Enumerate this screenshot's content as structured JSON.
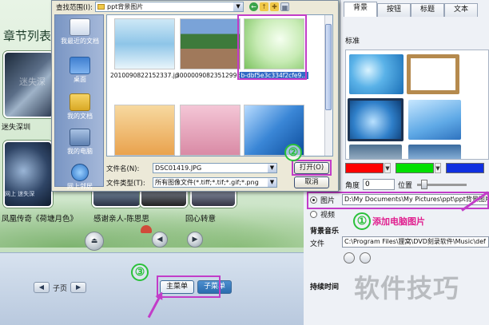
{
  "editor": {
    "chapter_title": "章节列表",
    "thumb1_watermark": "迷失深",
    "thumb1_caption": "迷失深圳",
    "thumb2_overlay": "网上 迷失深",
    "captions": [
      "凤凰传奇《荷塘月色》",
      "感谢亲人-陈思思",
      "回心转意"
    ],
    "up_button": "⏏",
    "prev_button": "◀",
    "next_button": "▶",
    "page_nav": {
      "prev": "◀",
      "label": "子页",
      "next": "▶"
    },
    "tabs": {
      "main_menu": "主菜单",
      "sub_menu": "子菜单"
    }
  },
  "panel": {
    "tabs": [
      "背景",
      "按钮",
      "标题",
      "文本"
    ],
    "active_tab": "背景",
    "standard_label": "标准",
    "colors": [
      "#ff0000",
      "#00e000",
      "#1030e0"
    ],
    "angle_label": "角度",
    "angle_value": "0",
    "position_label": "位置",
    "position_value": 0.1,
    "image_label": "图片",
    "image_path": "D:\\My Documents\\My Pictures\\ppt\\ppt背景图片\\",
    "video_label": "视频",
    "bg_music_label": "背景音乐",
    "file_label": "文件",
    "music_path": "C:\\Program Files\\狸窝\\DVD刻录软件\\Music\\def",
    "duration_label": "持续时间"
  },
  "annotations": {
    "step1": "①",
    "step1_text": "添加电脑图片",
    "step2": "②",
    "step3": "③",
    "colors": {
      "highlight": "#c23cc8",
      "circle": "#2ac13a",
      "text": "#e0208f"
    }
  },
  "watermark": "软件技巧",
  "dialog": {
    "look_in_label": "查找范围(I):",
    "look_in_value": "ppt背景图片",
    "toolbar": {
      "back": "←",
      "up": "↑",
      "new_folder": "✚",
      "views": "▦"
    },
    "places": [
      "我最近的文档",
      "桌面",
      "我的文档",
      "我的电脑",
      "网上邻居"
    ],
    "files": [
      "2010090822152337.jpg",
      "30000090823512996...",
      "b-dbf5e3c334f2cfe9...",
      "",
      "",
      ""
    ],
    "filename_label": "文件名(N):",
    "filename_value": "DSC01419.JPG",
    "filetype_label": "文件类型(T):",
    "filetype_value": "所有图像文件(*.tiff;*.tif;*.gif;*.png",
    "open_button": "打开(O)",
    "cancel_button": "取消"
  }
}
